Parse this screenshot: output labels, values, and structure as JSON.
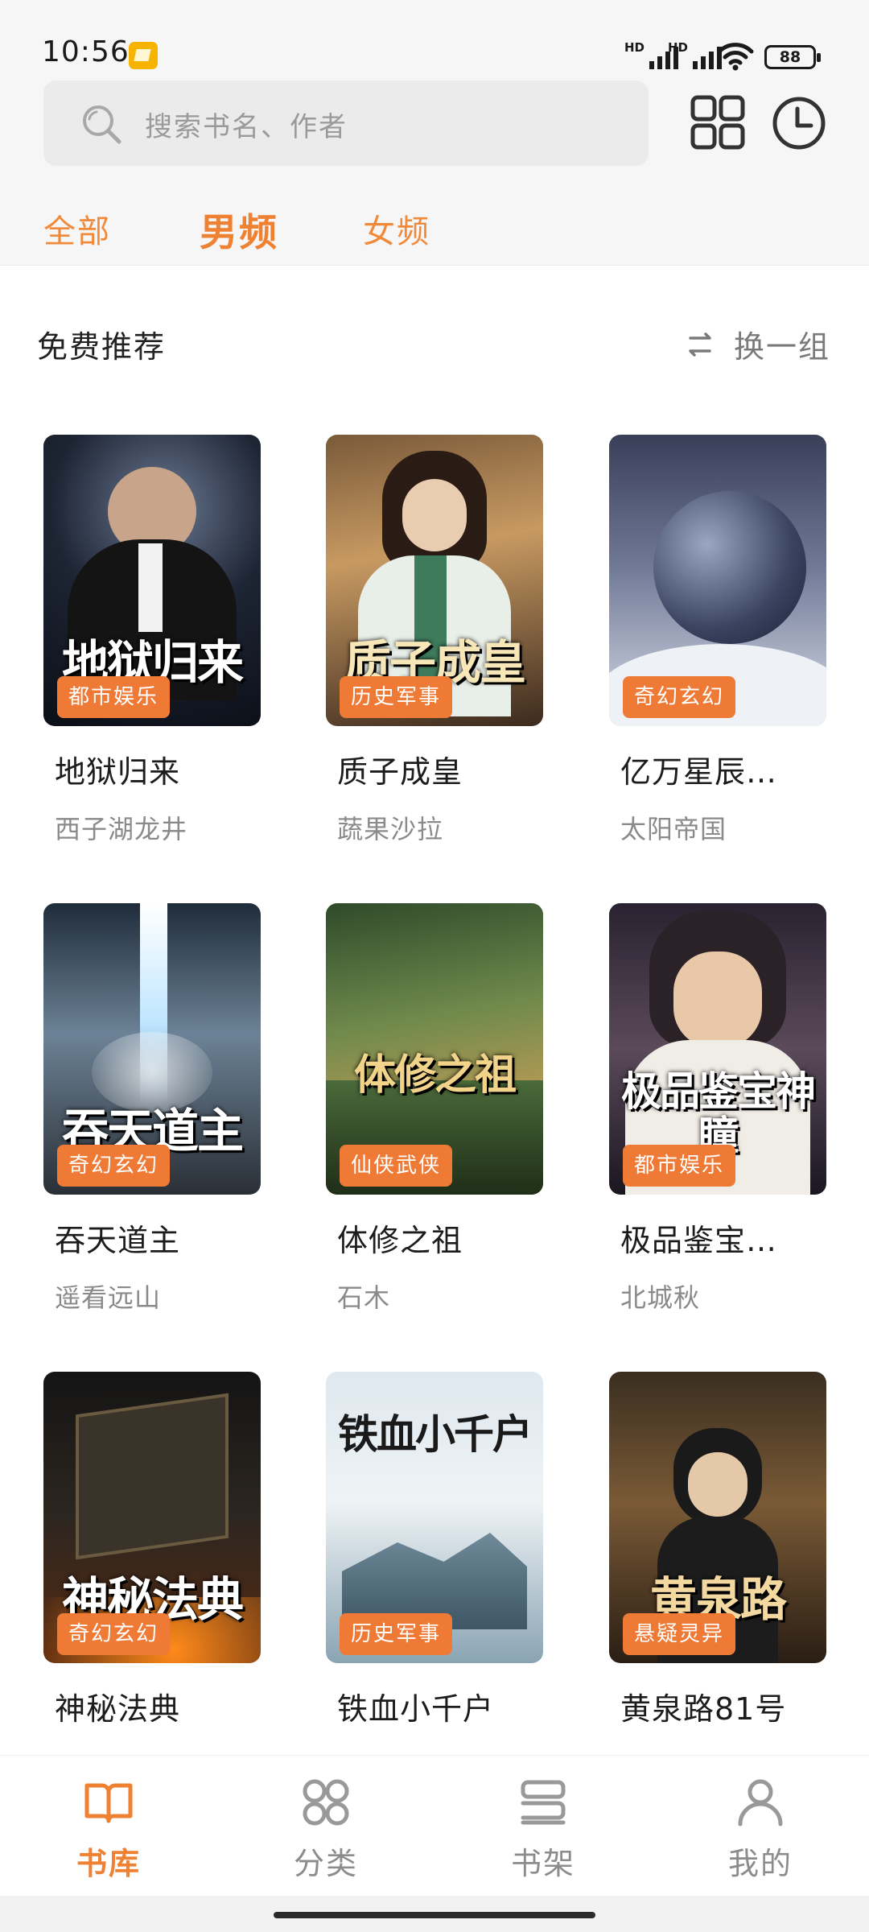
{
  "status_bar": {
    "time": "10:56",
    "signal_1_label": "HD",
    "signal_2_label": "HD",
    "battery": "88"
  },
  "search": {
    "placeholder": "搜索书名、作者"
  },
  "tabs": [
    {
      "label": "全部",
      "active": false
    },
    {
      "label": "男频",
      "active": true
    },
    {
      "label": "女频",
      "active": false
    }
  ],
  "section": {
    "title": "免费推荐",
    "refresh_label": "换一组"
  },
  "books": [
    {
      "cover_text": "地狱归来",
      "genre": "都市娱乐",
      "title": "地狱归来",
      "author": "西子湖龙井"
    },
    {
      "cover_text": "质子成皇",
      "genre": "历史军事",
      "title": "质子成皇",
      "author": "蔬果沙拉"
    },
    {
      "cover_text": "",
      "genre": "奇幻玄幻",
      "title": "亿万星辰…",
      "author": "太阳帝国"
    },
    {
      "cover_text": "吞天道主",
      "genre": "奇幻玄幻",
      "title": "吞天道主",
      "author": "遥看远山"
    },
    {
      "cover_text": "体修之祖",
      "genre": "仙侠武侠",
      "title": "体修之祖",
      "author": "石木"
    },
    {
      "cover_text": "极品鉴宝神瞳",
      "genre": "都市娱乐",
      "title": "极品鉴宝…",
      "author": "北城秋"
    },
    {
      "cover_text": "神秘法典",
      "genre": "奇幻玄幻",
      "title": "神秘法典",
      "author": ""
    },
    {
      "cover_text": "铁血小千户",
      "genre": "历史军事",
      "title": "铁血小千户",
      "author": ""
    },
    {
      "cover_text": "黄泉路",
      "genre": "悬疑灵异",
      "title": "黄泉路81号",
      "author": ""
    }
  ],
  "bottom_nav": [
    {
      "label": "书库",
      "icon": "open-book-icon",
      "active": true
    },
    {
      "label": "分类",
      "icon": "category-grid-icon",
      "active": false
    },
    {
      "label": "书架",
      "icon": "bookshelf-icon",
      "active": false
    },
    {
      "label": "我的",
      "icon": "profile-icon",
      "active": false
    }
  ],
  "colors": {
    "accent": "#ef8133",
    "badge": "#ee7a36",
    "header_bg": "#f6f6f6",
    "search_bg": "#ebebeb"
  }
}
